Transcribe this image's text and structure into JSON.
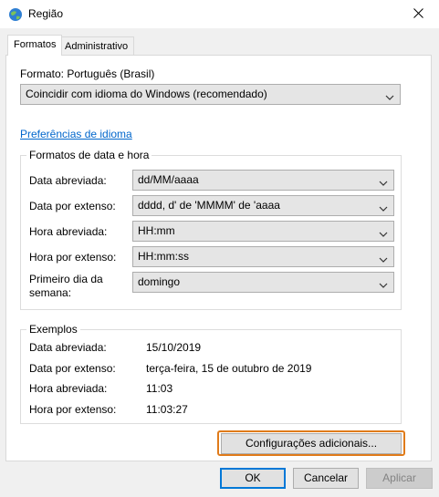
{
  "window": {
    "title": "Região"
  },
  "tabs": [
    {
      "label": "Formatos"
    },
    {
      "label": "Administrativo"
    }
  ],
  "format": {
    "label": "Formato: Português (Brasil)",
    "selected": "Coincidir com idioma do Windows (recomendado)"
  },
  "language_prefs_link": "Preferências de idioma",
  "date_time_group": {
    "title": "Formatos de data e hora",
    "rows": [
      {
        "label": "Data abreviada:",
        "value": "dd/MM/aaaa"
      },
      {
        "label": "Data por extenso:",
        "value": "dddd, d' de 'MMMM' de 'aaaa"
      },
      {
        "label": "Hora abreviada:",
        "value": "HH:mm"
      },
      {
        "label": "Hora por extenso:",
        "value": "HH:mm:ss"
      },
      {
        "label_line1": "Primeiro dia da",
        "label_line2": "semana:",
        "value": "domingo"
      }
    ]
  },
  "examples_group": {
    "title": "Exemplos",
    "rows": [
      {
        "label": "Data abreviada:",
        "value": "15/10/2019"
      },
      {
        "label": "Data por extenso:",
        "value": "terça-feira, 15 de outubro de 2019"
      },
      {
        "label": "Hora abreviada:",
        "value": "11:03"
      },
      {
        "label": "Hora por extenso:",
        "value": "11:03:27"
      }
    ]
  },
  "buttons": {
    "additional_settings": "Configurações adicionais...",
    "ok": "OK",
    "cancel": "Cancelar",
    "apply": "Aplicar"
  },
  "colors": {
    "link": "#0066cc",
    "highlight": "#e07b1a",
    "primary_border": "#0078d7"
  }
}
